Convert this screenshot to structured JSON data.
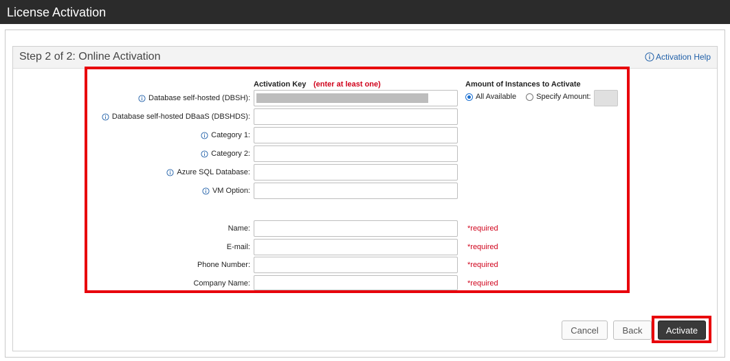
{
  "window": {
    "title": "License Activation"
  },
  "panel": {
    "title": "Step 2 of 2: Online Activation",
    "help_link": "Activation Help"
  },
  "columns": {
    "activation_key": "Activation Key",
    "enter_note": "(enter at least one)",
    "amount": "Amount of Instances to Activate"
  },
  "key_fields": [
    {
      "label": "Database self-hosted (DBSH):",
      "value": "(masked)"
    },
    {
      "label": "Database self-hosted DBaaS (DBSHDS):",
      "value": ""
    },
    {
      "label": "Category 1:",
      "value": ""
    },
    {
      "label": "Category 2:",
      "value": ""
    },
    {
      "label": "Azure SQL Database:",
      "value": ""
    },
    {
      "label": "VM Option:",
      "value": ""
    }
  ],
  "amount": {
    "all_available_label": "All Available",
    "specify_amount_label": "Specify Amount:",
    "selected": "All Available"
  },
  "contact_fields": [
    {
      "label": "Name:",
      "value": "",
      "note": "*required"
    },
    {
      "label": "E-mail:",
      "value": "",
      "note": "*required"
    },
    {
      "label": "Phone Number:",
      "value": "",
      "note": "*required"
    },
    {
      "label": "Company Name:",
      "value": "",
      "note": "*required"
    }
  ],
  "buttons": {
    "cancel": "Cancel",
    "back": "Back",
    "activate": "Activate"
  },
  "colors": {
    "title_bar": "#2b2b2b",
    "highlight": "#e8000b",
    "required": "#d0021b",
    "link": "#1f5fa8"
  }
}
